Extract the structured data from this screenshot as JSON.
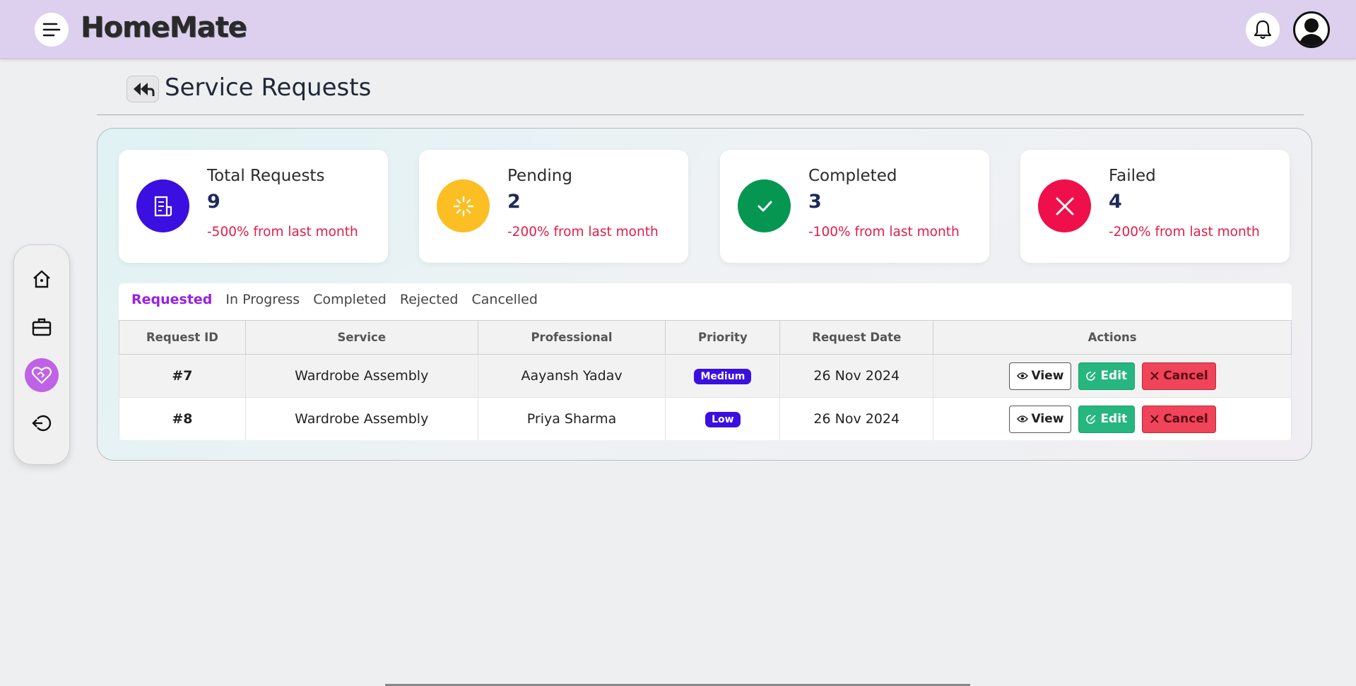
{
  "app": {
    "brand": "HomeMate"
  },
  "header": {
    "menu_icon": "menu-icon",
    "bell_icon": "bell-icon",
    "avatar_icon": "user-avatar-icon"
  },
  "page": {
    "title": "Service Requests"
  },
  "sidenav": {
    "items": [
      "home-icon",
      "briefcase-icon",
      "heart-handshake-icon",
      "logout-icon"
    ],
    "active_index": 2
  },
  "stats": [
    {
      "label": "Total Requests",
      "value": "9",
      "change": "-500% from last month",
      "icon": "document-icon",
      "color": "#3b0fe0"
    },
    {
      "label": "Pending",
      "value": "2",
      "change": "-200% from last month",
      "icon": "loader-icon",
      "color": "#fbbf24"
    },
    {
      "label": "Completed",
      "value": "3",
      "change": "-100% from last month",
      "icon": "check-icon",
      "color": "#059652"
    },
    {
      "label": "Failed",
      "value": "4",
      "change": "-200% from last month",
      "icon": "x-icon",
      "color": "#ef0f4a"
    }
  ],
  "tabs": [
    "Requested",
    "In Progress",
    "Completed",
    "Rejected",
    "Cancelled"
  ],
  "active_tab": "Requested",
  "table": {
    "headers": [
      "Request ID",
      "Service",
      "Professional",
      "Priority",
      "Request Date",
      "Actions"
    ],
    "rows": [
      {
        "id": "#7",
        "service": "Wardrobe Assembly",
        "professional": "Aayansh Yadav",
        "priority": "Medium",
        "date": "26 Nov 2024"
      },
      {
        "id": "#8",
        "service": "Wardrobe Assembly",
        "professional": "Priya Sharma",
        "priority": "Low",
        "date": "26 Nov 2024"
      }
    ],
    "actions": {
      "view": "View",
      "edit": "Edit",
      "cancel": "Cancel"
    }
  }
}
